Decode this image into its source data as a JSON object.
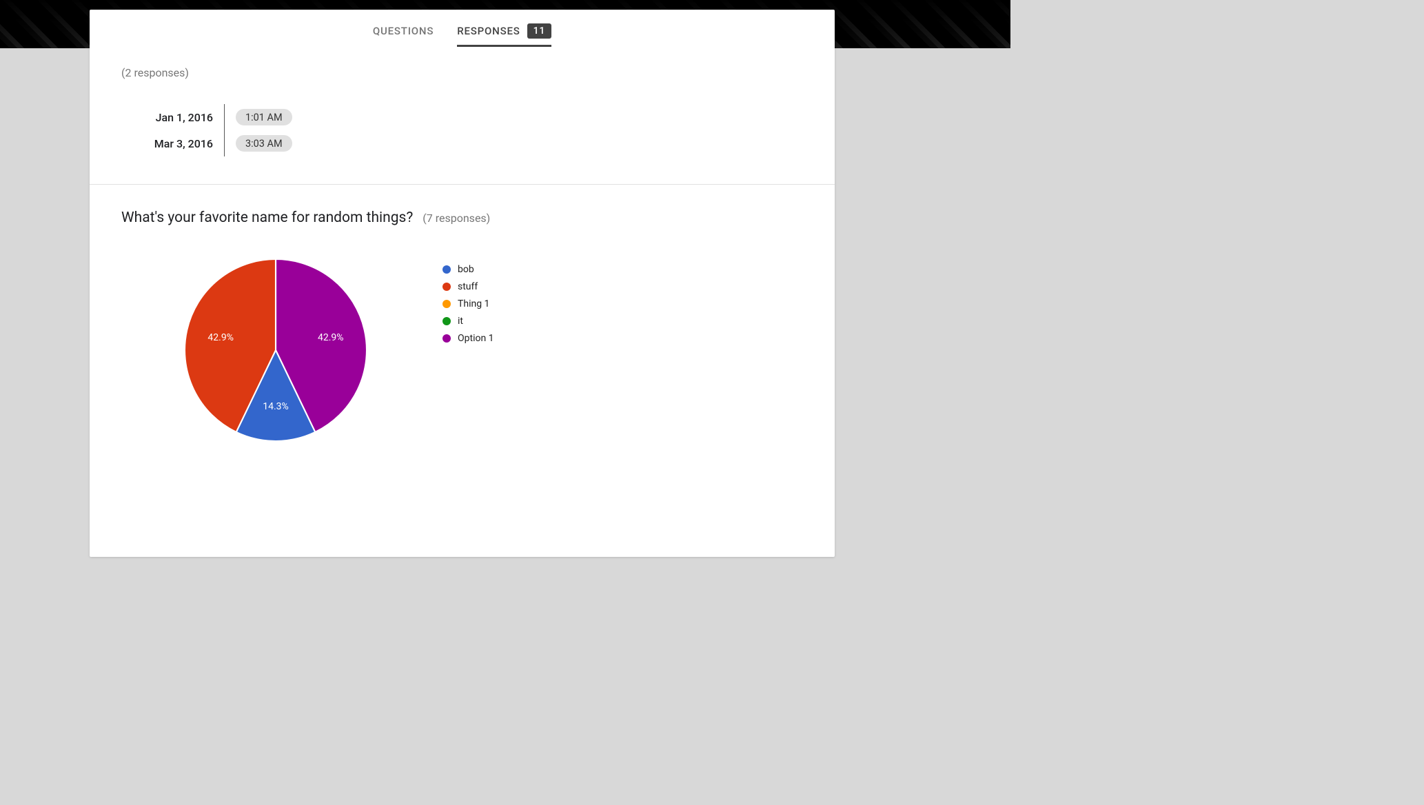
{
  "tabs": {
    "questions": "QUESTIONS",
    "responses": "RESPONSES",
    "badge": "11"
  },
  "timeSection": {
    "countLabel": "(2 responses)",
    "rows": [
      {
        "date": "Jan 1, 2016",
        "time": "1:01 AM"
      },
      {
        "date": "Mar 3, 2016",
        "time": "3:03 AM"
      }
    ]
  },
  "question": {
    "title": "What's your favorite name for random things?",
    "countLabel": "(7 responses)"
  },
  "chart_data": {
    "type": "pie",
    "title": "What's your favorite name for random things?",
    "categories": [
      "bob",
      "stuff",
      "Thing 1",
      "it",
      "Option 1"
    ],
    "values": [
      14.3,
      42.9,
      0,
      0,
      42.9
    ],
    "counts": [
      1,
      3,
      0,
      0,
      3
    ],
    "total_responses": 7,
    "colors": {
      "bob": "#3366cc",
      "stuff": "#dc3912",
      "Thing 1": "#ff9900",
      "it": "#109618",
      "Option 1": "#990099"
    },
    "slice_labels": [
      "14.3%",
      "42.9%",
      "",
      "",
      "42.9%"
    ],
    "legend_position": "right"
  }
}
